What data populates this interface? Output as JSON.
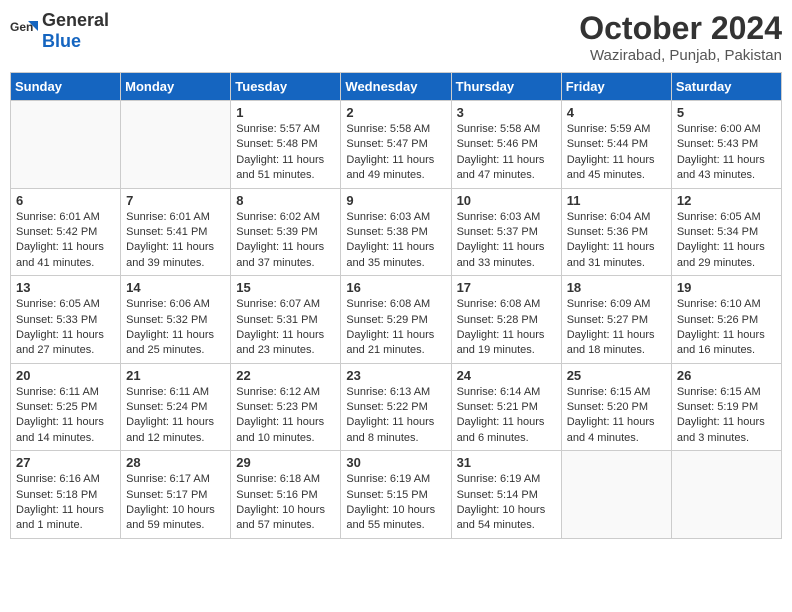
{
  "logo": {
    "general": "General",
    "blue": "Blue"
  },
  "title": "October 2024",
  "location": "Wazirabad, Punjab, Pakistan",
  "days_of_week": [
    "Sunday",
    "Monday",
    "Tuesday",
    "Wednesday",
    "Thursday",
    "Friday",
    "Saturday"
  ],
  "weeks": [
    [
      {
        "day": "",
        "info": ""
      },
      {
        "day": "",
        "info": ""
      },
      {
        "day": "1",
        "info": "Sunrise: 5:57 AM\nSunset: 5:48 PM\nDaylight: 11 hours and 51 minutes."
      },
      {
        "day": "2",
        "info": "Sunrise: 5:58 AM\nSunset: 5:47 PM\nDaylight: 11 hours and 49 minutes."
      },
      {
        "day": "3",
        "info": "Sunrise: 5:58 AM\nSunset: 5:46 PM\nDaylight: 11 hours and 47 minutes."
      },
      {
        "day": "4",
        "info": "Sunrise: 5:59 AM\nSunset: 5:44 PM\nDaylight: 11 hours and 45 minutes."
      },
      {
        "day": "5",
        "info": "Sunrise: 6:00 AM\nSunset: 5:43 PM\nDaylight: 11 hours and 43 minutes."
      }
    ],
    [
      {
        "day": "6",
        "info": "Sunrise: 6:01 AM\nSunset: 5:42 PM\nDaylight: 11 hours and 41 minutes."
      },
      {
        "day": "7",
        "info": "Sunrise: 6:01 AM\nSunset: 5:41 PM\nDaylight: 11 hours and 39 minutes."
      },
      {
        "day": "8",
        "info": "Sunrise: 6:02 AM\nSunset: 5:39 PM\nDaylight: 11 hours and 37 minutes."
      },
      {
        "day": "9",
        "info": "Sunrise: 6:03 AM\nSunset: 5:38 PM\nDaylight: 11 hours and 35 minutes."
      },
      {
        "day": "10",
        "info": "Sunrise: 6:03 AM\nSunset: 5:37 PM\nDaylight: 11 hours and 33 minutes."
      },
      {
        "day": "11",
        "info": "Sunrise: 6:04 AM\nSunset: 5:36 PM\nDaylight: 11 hours and 31 minutes."
      },
      {
        "day": "12",
        "info": "Sunrise: 6:05 AM\nSunset: 5:34 PM\nDaylight: 11 hours and 29 minutes."
      }
    ],
    [
      {
        "day": "13",
        "info": "Sunrise: 6:05 AM\nSunset: 5:33 PM\nDaylight: 11 hours and 27 minutes."
      },
      {
        "day": "14",
        "info": "Sunrise: 6:06 AM\nSunset: 5:32 PM\nDaylight: 11 hours and 25 minutes."
      },
      {
        "day": "15",
        "info": "Sunrise: 6:07 AM\nSunset: 5:31 PM\nDaylight: 11 hours and 23 minutes."
      },
      {
        "day": "16",
        "info": "Sunrise: 6:08 AM\nSunset: 5:29 PM\nDaylight: 11 hours and 21 minutes."
      },
      {
        "day": "17",
        "info": "Sunrise: 6:08 AM\nSunset: 5:28 PM\nDaylight: 11 hours and 19 minutes."
      },
      {
        "day": "18",
        "info": "Sunrise: 6:09 AM\nSunset: 5:27 PM\nDaylight: 11 hours and 18 minutes."
      },
      {
        "day": "19",
        "info": "Sunrise: 6:10 AM\nSunset: 5:26 PM\nDaylight: 11 hours and 16 minutes."
      }
    ],
    [
      {
        "day": "20",
        "info": "Sunrise: 6:11 AM\nSunset: 5:25 PM\nDaylight: 11 hours and 14 minutes."
      },
      {
        "day": "21",
        "info": "Sunrise: 6:11 AM\nSunset: 5:24 PM\nDaylight: 11 hours and 12 minutes."
      },
      {
        "day": "22",
        "info": "Sunrise: 6:12 AM\nSunset: 5:23 PM\nDaylight: 11 hours and 10 minutes."
      },
      {
        "day": "23",
        "info": "Sunrise: 6:13 AM\nSunset: 5:22 PM\nDaylight: 11 hours and 8 minutes."
      },
      {
        "day": "24",
        "info": "Sunrise: 6:14 AM\nSunset: 5:21 PM\nDaylight: 11 hours and 6 minutes."
      },
      {
        "day": "25",
        "info": "Sunrise: 6:15 AM\nSunset: 5:20 PM\nDaylight: 11 hours and 4 minutes."
      },
      {
        "day": "26",
        "info": "Sunrise: 6:15 AM\nSunset: 5:19 PM\nDaylight: 11 hours and 3 minutes."
      }
    ],
    [
      {
        "day": "27",
        "info": "Sunrise: 6:16 AM\nSunset: 5:18 PM\nDaylight: 11 hours and 1 minute."
      },
      {
        "day": "28",
        "info": "Sunrise: 6:17 AM\nSunset: 5:17 PM\nDaylight: 10 hours and 59 minutes."
      },
      {
        "day": "29",
        "info": "Sunrise: 6:18 AM\nSunset: 5:16 PM\nDaylight: 10 hours and 57 minutes."
      },
      {
        "day": "30",
        "info": "Sunrise: 6:19 AM\nSunset: 5:15 PM\nDaylight: 10 hours and 55 minutes."
      },
      {
        "day": "31",
        "info": "Sunrise: 6:19 AM\nSunset: 5:14 PM\nDaylight: 10 hours and 54 minutes."
      },
      {
        "day": "",
        "info": ""
      },
      {
        "day": "",
        "info": ""
      }
    ]
  ]
}
